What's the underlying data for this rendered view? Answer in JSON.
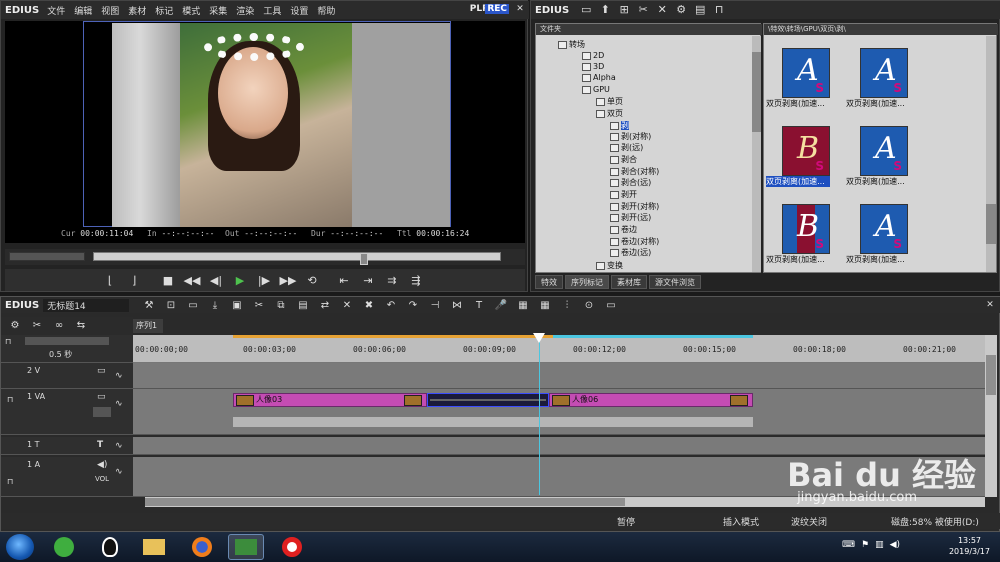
{
  "preview": {
    "logo": "EDIUS",
    "menu": [
      "文件",
      "编辑",
      "视图",
      "素材",
      "标记",
      "模式",
      "采集",
      "渲染",
      "工具",
      "设置",
      "帮助"
    ],
    "plr": "PLR",
    "rec": "REC",
    "timecodes": {
      "cur_label": "Cur",
      "cur_value": "00:00:11:04",
      "in_label": "In",
      "in_value": "--:--:--:--",
      "out_label": "Out",
      "out_value": "--:--:--:--",
      "dur_label": "Dur",
      "dur_value": "--:--:--:--",
      "ttl_label": "Ttl",
      "ttl_value": "00:00:16:24"
    }
  },
  "bin": {
    "logo": "EDIUS",
    "tree_header": "文件夹",
    "asset_header": "\\特效\\转场\\GPU\\双页\\剥\\",
    "tree": [
      {
        "label": "转场",
        "level": 1
      },
      {
        "label": "2D",
        "level": 2
      },
      {
        "label": "3D",
        "level": 2
      },
      {
        "label": "Alpha",
        "level": 2
      },
      {
        "label": "GPU",
        "level": 2
      },
      {
        "label": "单页",
        "level": 3
      },
      {
        "label": "双页",
        "level": 3
      },
      {
        "label": "剥",
        "level": 4,
        "selected": true
      },
      {
        "label": "剥(对称)",
        "level": 4
      },
      {
        "label": "剥(远)",
        "level": 4
      },
      {
        "label": "剥合",
        "level": 4
      },
      {
        "label": "剥合(对称)",
        "level": 4
      },
      {
        "label": "剥合(远)",
        "level": 4
      },
      {
        "label": "剥开",
        "level": 4
      },
      {
        "label": "剥开(对称)",
        "level": 4
      },
      {
        "label": "剥开(远)",
        "level": 4
      },
      {
        "label": "卷边",
        "level": 4
      },
      {
        "label": "卷边(对称)",
        "level": 4
      },
      {
        "label": "卷边(远)",
        "level": 4
      },
      {
        "label": "变换",
        "level": 3
      }
    ],
    "assets": [
      {
        "caption": "双页剥离(加速...",
        "letter": "A",
        "selected": false
      },
      {
        "caption": "双页剥离(加速...",
        "letter": "A",
        "selected": false
      },
      {
        "caption": "双页剥离(加速...",
        "letter": "B",
        "selected": true
      },
      {
        "caption": "双页剥离(加速...",
        "letter": "A",
        "selected": false
      },
      {
        "caption": "双页剥离(加速...",
        "letter": "B",
        "selected": false
      },
      {
        "caption": "双页剥离(加速...",
        "letter": "A",
        "selected": false
      }
    ],
    "tabs": [
      "特效",
      "序列标记",
      "素材库",
      "源文件浏览"
    ]
  },
  "timeline": {
    "logo": "EDIUS",
    "project": "无标题14",
    "sequence_tab": "序列1",
    "zoom": "0.5 秒",
    "ruler_labels": [
      "00:00:00;00",
      "00:00:03;00",
      "00:00:06;00",
      "00:00:09;00",
      "00:00:12;00",
      "00:00:15;00",
      "00:00:18;00",
      "00:00:21;00"
    ],
    "tracks": [
      {
        "name": "2 V"
      },
      {
        "name": "1 VA"
      },
      {
        "name": "1 T"
      },
      {
        "name": "1 A"
      }
    ],
    "vol_label": "VOL",
    "clips": [
      {
        "label": "人像03"
      },
      {
        "label": "人像06"
      }
    ]
  },
  "status": {
    "pause": "暂停",
    "insert_mode": "插入模式",
    "ripple_off": "波纹关闭",
    "disk": "磁盘:58% 被使用(D:)"
  },
  "taskbar": {
    "time": "13:57",
    "date": "2019/3/17"
  },
  "watermark": {
    "brand": "Bai du 经验",
    "url": "jingyan.baidu.com"
  },
  "colors": {
    "rec_bg": "#2b56c9",
    "clip": "#c44cb3",
    "cursor_line": "#4bc6e0",
    "in_out_bar": "#e6a234",
    "selection": "#1e4fc0"
  }
}
